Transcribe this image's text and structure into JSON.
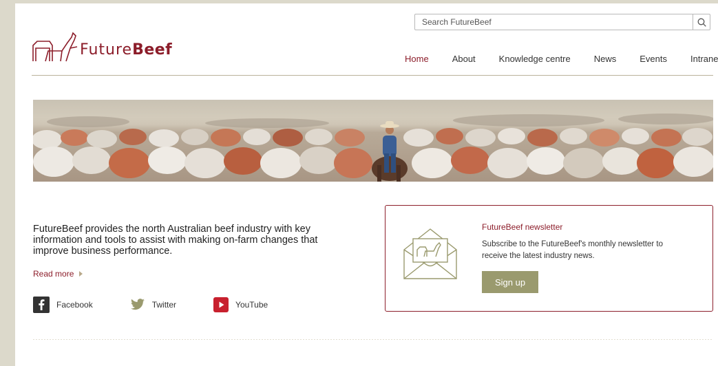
{
  "header": {
    "logo_text_regular": "Future",
    "logo_text_bold": "Beef",
    "search_placeholder": "Search FutureBeef"
  },
  "nav": {
    "items": [
      {
        "label": "Home",
        "active": true
      },
      {
        "label": "About"
      },
      {
        "label": "Knowledge centre"
      },
      {
        "label": "News"
      },
      {
        "label": "Events"
      },
      {
        "label": "Intranet"
      }
    ]
  },
  "intro": {
    "text": "FutureBeef provides the north Australian beef industry with key information and tools to assist with making on-farm changes that improve business performance.",
    "read_more": "Read more"
  },
  "social": {
    "facebook": "Facebook",
    "twitter": "Twitter",
    "youtube": "YouTube"
  },
  "newsletter": {
    "title": "FutureBeef newsletter",
    "description": "Subscribe to the FutureBeef's monthly newsletter to receive the latest industry news.",
    "button": "Sign up"
  },
  "colors": {
    "brand": "#8c1d2a",
    "button": "#9a9a6e",
    "page_bg": "#dcd9cb"
  },
  "icons": [
    "logo-cattle-icon",
    "search-icon",
    "facebook-icon",
    "twitter-icon",
    "youtube-icon",
    "envelope-icon",
    "chevron-right-icon"
  ]
}
